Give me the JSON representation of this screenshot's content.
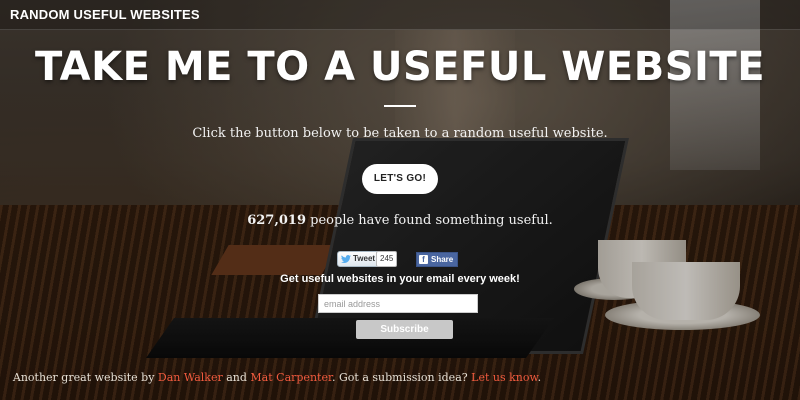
{
  "header": {
    "brand": "RANDOM USEFUL WEBSITES"
  },
  "hero": {
    "headline": "TAKE ME TO A USEFUL WEBSITE",
    "subtitle": "Click the button below to be taken to a random useful website.",
    "button_label": "LET'S GO!",
    "count": "627,019",
    "count_suffix": " people have found something useful."
  },
  "social": {
    "tweet_label": "Tweet",
    "tweet_count": "245",
    "share_label": "Share",
    "colors": {
      "facebook": "#4a66a0",
      "twitter_bird": "#55acee"
    }
  },
  "newsletter": {
    "label": "Get useful websites in your email every week!",
    "placeholder": "email address",
    "button_label": "Subscribe"
  },
  "footer": {
    "prefix": "Another great website by ",
    "author1": "Dan Walker",
    "and": " and ",
    "author2": "Mat Carpenter",
    "mid": ". Got a submission idea? ",
    "contact": "Let us know",
    "end": ".",
    "link_color": "#f05a3e"
  }
}
